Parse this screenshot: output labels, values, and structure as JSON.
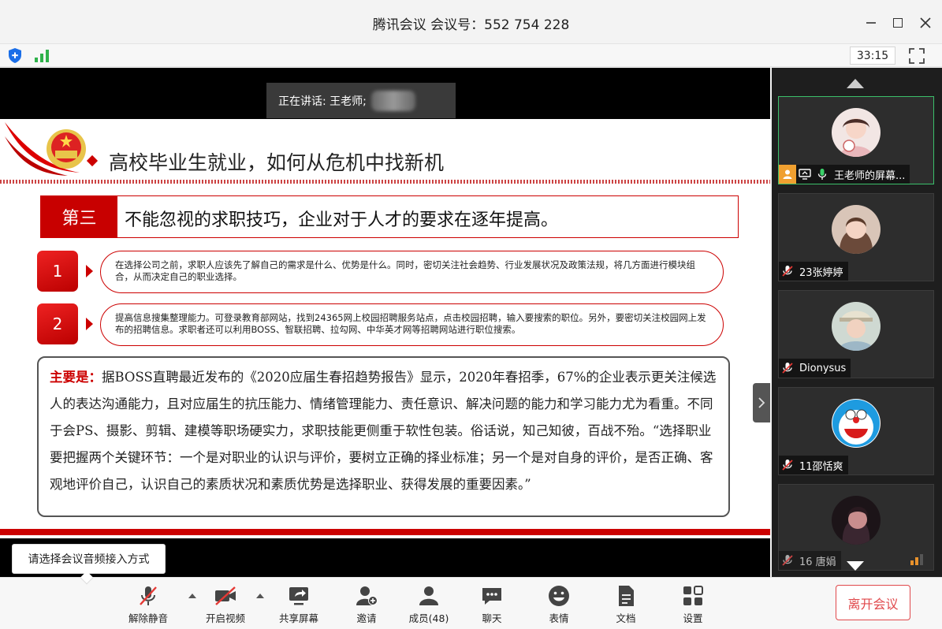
{
  "window": {
    "title": "腾讯会议 会议号：552 754 228",
    "minimize_icon": "minimize-icon",
    "maximize_icon": "maximize-icon",
    "close_icon": "close-icon"
  },
  "statusbar": {
    "timer": "33:15",
    "security_icon": "shield-icon",
    "network_icon": "signal-icon",
    "fullscreen_icon": "fullscreen-icon"
  },
  "stage": {
    "speaking_label": "正在讲话: 王老师;",
    "slide": {
      "title": "高校毕业生就业，如何从危机中找新机",
      "section_label": "第三",
      "section_text": "不能忽视的求职技巧，企业对于人才的要求在逐年提高。",
      "points": [
        {
          "num": "1",
          "text": "在选择公司之前，求职人应该先了解自己的需求是什么、优势是什么。同时，密切关注社会趋势、行业发展状况及政策法规，将几方面进行模块组合，从而决定自己的职业选择。"
        },
        {
          "num": "2",
          "text": "提高信息搜集整理能力。可登录教育部网站，找到24365网上校园招聘服务站点，点击校园招聘，输入要搜索的职位。另外，要密切关注校园网上发布的招聘信息。求职者还可以利用BOSS、智联招聘、拉勾网、中华英才网等招聘网站进行职位搜索。"
        }
      ],
      "main_label": "主要是：",
      "main_text": "据BOSS直聘最近发布的《2020应届生春招趋势报告》显示，2020年春招季，67%的企业表示更关注候选人的表达沟通能力，且对应届生的抗压能力、情绪管理能力、责任意识、解决问题的能力和学习能力尤为看重。不同于会PS、摄影、剪辑、建模等职场硬实力，求职技能更侧重于软性包装。俗话说，知己知彼，百战不殆。“选择职业要把握两个关键环节：一个是对职业的认识与评价，要树立正确的择业标准；另一个是对自身的评价，是否正确、客观地评价自己，认识自己的素质状况和素质优势是选择职业、获得发展的重要因素。”"
    },
    "tooltip": "请选择会议音频接入方式"
  },
  "participants": [
    {
      "name": "王老师的屏幕...",
      "active": true,
      "mic": "mic-on"
    },
    {
      "name": "23张婷婷",
      "active": false,
      "mic": "mic-muted"
    },
    {
      "name": "Dionysus",
      "active": false,
      "mic": "mic-muted"
    },
    {
      "name": "11邵恬爽",
      "active": false,
      "mic": "mic-muted"
    },
    {
      "name": "16 唐娟",
      "active": false,
      "mic": "mic-muted"
    }
  ],
  "toolbar": {
    "unmute": "解除静音",
    "start_video": "开启视频",
    "share_screen": "共享屏幕",
    "invite": "邀请",
    "members": "成员(48)",
    "chat": "聊天",
    "reactions": "表情",
    "docs": "文档",
    "settings": "设置",
    "leave": "离开会议"
  },
  "colors": {
    "accent_red": "#c80000",
    "leave_red": "#e0484b",
    "active_green": "#3bbf6a",
    "panel_bg": "#1e1e1e"
  }
}
